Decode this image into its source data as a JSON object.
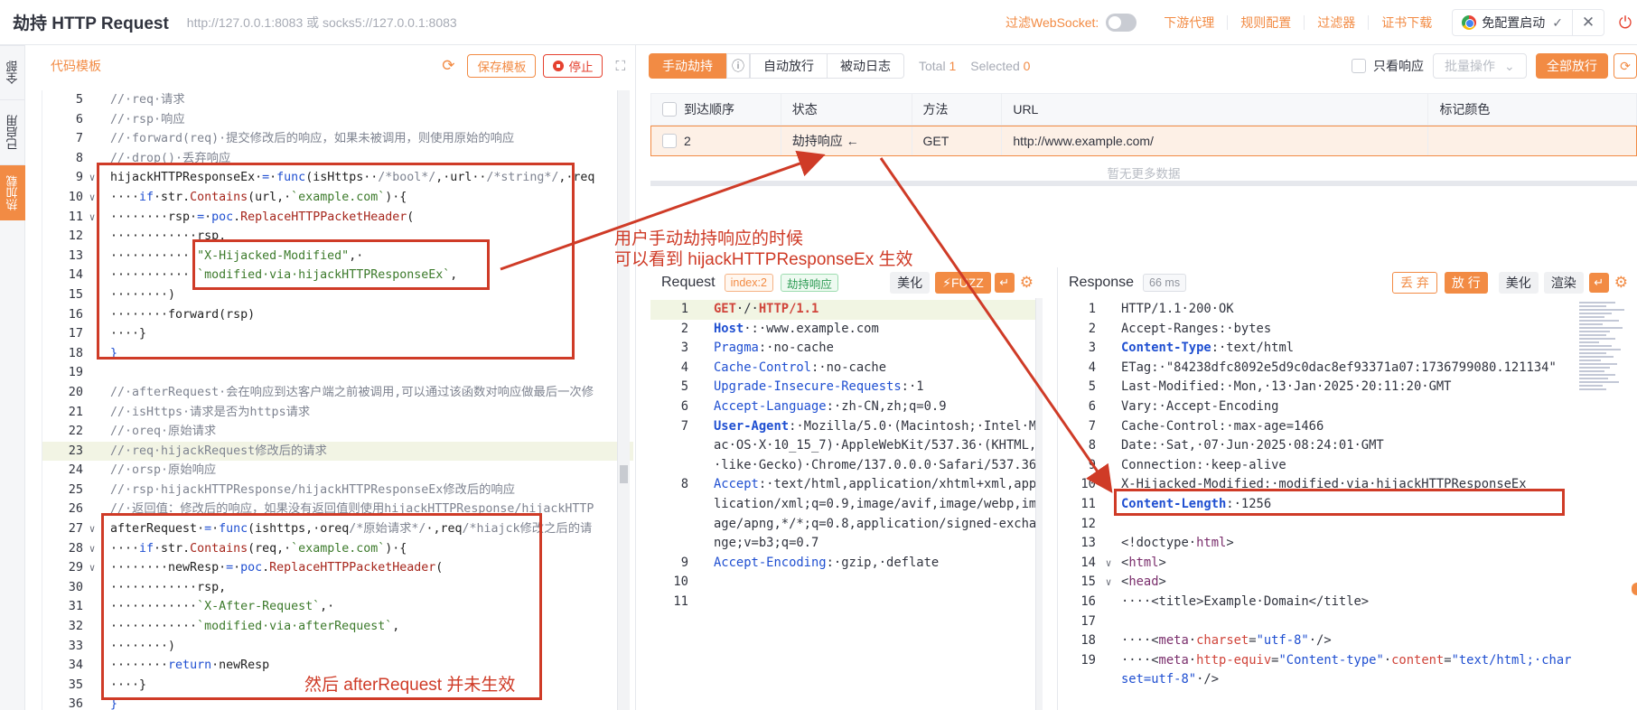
{
  "header": {
    "title": "劫持 HTTP Request",
    "proxy_addr": "http://127.0.0.1:8083 或 socks5://127.0.0.1:8083",
    "ws_filter_label": "过滤WebSocket",
    "links": [
      "下游代理",
      "规则配置",
      "过滤器",
      "证书下载"
    ],
    "chrome_button": "免配置启动"
  },
  "side_tabs": [
    "全部",
    "已启用",
    "热加载"
  ],
  "editor": {
    "title": "代码模板",
    "save_label": "保存模板",
    "stop_label": "停止",
    "lines": [
      {
        "n": "5",
        "f": "",
        "h": false,
        "segs": [
          [
            "c-cm",
            "//·req·请求"
          ]
        ]
      },
      {
        "n": "6",
        "f": "",
        "h": false,
        "segs": [
          [
            "c-cm",
            "//·rsp·响应"
          ]
        ]
      },
      {
        "n": "7",
        "f": "",
        "h": false,
        "segs": [
          [
            "c-cm",
            "//·forward(req)·提交修改后的响应，如果未被调用，则使用原始的响应"
          ]
        ]
      },
      {
        "n": "8",
        "f": "",
        "h": false,
        "segs": [
          [
            "c-cm",
            "//·drop()·丢弃响应"
          ]
        ]
      },
      {
        "n": "9",
        "f": "∨",
        "h": false,
        "segs": [
          [
            "c-pl",
            "hijackHTTPResponseEx·"
          ],
          [
            "c-kw",
            "="
          ],
          [
            "c-pl",
            "·"
          ],
          [
            "c-kw",
            "func"
          ],
          [
            "c-pl",
            "(isHttps··"
          ],
          [
            "c-cm",
            "/*bool*/"
          ],
          [
            "c-pl",
            ",·url··"
          ],
          [
            "c-cm",
            "/*string*/"
          ],
          [
            "c-pl",
            ",·req"
          ]
        ]
      },
      {
        "n": "10",
        "f": "∨",
        "h": false,
        "segs": [
          [
            "c-pl",
            "····"
          ],
          [
            "c-kw",
            "if"
          ],
          [
            "c-pl",
            "·str."
          ],
          [
            "c-fn",
            "Contains"
          ],
          [
            "c-pl",
            "(url,·"
          ],
          [
            "c-st",
            "`example.com`"
          ],
          [
            "c-pl",
            ")·{"
          ]
        ]
      },
      {
        "n": "11",
        "f": "∨",
        "h": false,
        "segs": [
          [
            "c-pl",
            "········rsp·"
          ],
          [
            "c-kw",
            "="
          ],
          [
            "c-pl",
            "·"
          ],
          [
            "c-kw",
            "poc"
          ],
          [
            "c-pl",
            "."
          ],
          [
            "c-fn",
            "ReplaceHTTPPacketHeader"
          ],
          [
            "c-pl",
            "("
          ]
        ]
      },
      {
        "n": "12",
        "f": "",
        "h": false,
        "segs": [
          [
            "c-pl",
            "············rsp,"
          ]
        ]
      },
      {
        "n": "13",
        "f": "",
        "h": false,
        "segs": [
          [
            "c-pl",
            "············"
          ],
          [
            "c-st",
            "\"X-Hijacked-Modified\""
          ],
          [
            "c-pl",
            ",·"
          ]
        ]
      },
      {
        "n": "14",
        "f": "",
        "h": false,
        "segs": [
          [
            "c-pl",
            "············"
          ],
          [
            "c-st",
            "`modified·via·hijackHTTPResponseEx`"
          ],
          [
            "c-pl",
            ","
          ]
        ]
      },
      {
        "n": "15",
        "f": "",
        "h": false,
        "segs": [
          [
            "c-pl",
            "········)"
          ]
        ]
      },
      {
        "n": "16",
        "f": "",
        "h": false,
        "segs": [
          [
            "c-pl",
            "········forward(rsp)"
          ]
        ]
      },
      {
        "n": "17",
        "f": "",
        "h": false,
        "segs": [
          [
            "c-pl",
            "····}"
          ]
        ]
      },
      {
        "n": "18",
        "f": "",
        "h": false,
        "segs": [
          [
            "c-kw",
            "}"
          ]
        ]
      },
      {
        "n": "19",
        "f": "",
        "h": false,
        "segs": [
          [
            "c-pl",
            ""
          ]
        ]
      },
      {
        "n": "20",
        "f": "",
        "h": false,
        "segs": [
          [
            "c-cm",
            "//·afterRequest·会在响应到达客户端之前被调用,可以通过该函数对响应做最后一次修"
          ]
        ]
      },
      {
        "n": "21",
        "f": "",
        "h": false,
        "segs": [
          [
            "c-cm",
            "//·isHttps·请求是否为https请求"
          ]
        ]
      },
      {
        "n": "22",
        "f": "",
        "h": false,
        "segs": [
          [
            "c-cm",
            "//·oreq·原始请求"
          ]
        ]
      },
      {
        "n": "23",
        "f": "",
        "h": true,
        "segs": [
          [
            "c-cm",
            "//·req·hijackRequest修改后的请求"
          ]
        ]
      },
      {
        "n": "24",
        "f": "",
        "h": false,
        "segs": [
          [
            "c-cm",
            "//·orsp·原始响应"
          ]
        ]
      },
      {
        "n": "25",
        "f": "",
        "h": false,
        "segs": [
          [
            "c-cm",
            "//·rsp·hijackHTTPResponse/hijackHTTPResponseEx修改后的响应"
          ]
        ]
      },
      {
        "n": "26",
        "f": "",
        "h": false,
        "segs": [
          [
            "c-cm",
            "//·返回值：修改后的响应，如果没有返回值则使用hijackHTTPResponse/hijackHTTP"
          ]
        ]
      },
      {
        "n": "27",
        "f": "∨",
        "h": false,
        "segs": [
          [
            "c-pl",
            "afterRequest·"
          ],
          [
            "c-kw",
            "="
          ],
          [
            "c-pl",
            "·"
          ],
          [
            "c-kw",
            "func"
          ],
          [
            "c-pl",
            "(ishttps,·oreq"
          ],
          [
            "c-cm",
            "/*原始请求*/"
          ],
          [
            "c-pl",
            "·,req"
          ],
          [
            "c-cm",
            "/*hiajck修改之后的请"
          ]
        ]
      },
      {
        "n": "28",
        "f": "∨",
        "h": false,
        "segs": [
          [
            "c-pl",
            "····"
          ],
          [
            "c-kw",
            "if"
          ],
          [
            "c-pl",
            "·str."
          ],
          [
            "c-fn",
            "Contains"
          ],
          [
            "c-pl",
            "(req,·"
          ],
          [
            "c-st",
            "`example.com`"
          ],
          [
            "c-pl",
            ")·{"
          ]
        ]
      },
      {
        "n": "29",
        "f": "∨",
        "h": false,
        "segs": [
          [
            "c-pl",
            "········newResp·"
          ],
          [
            "c-kw",
            "="
          ],
          [
            "c-pl",
            "·"
          ],
          [
            "c-kw",
            "poc"
          ],
          [
            "c-pl",
            "."
          ],
          [
            "c-fn",
            "ReplaceHTTPPacketHeader"
          ],
          [
            "c-pl",
            "("
          ]
        ]
      },
      {
        "n": "30",
        "f": "",
        "h": false,
        "segs": [
          [
            "c-pl",
            "············rsp,"
          ]
        ]
      },
      {
        "n": "31",
        "f": "",
        "h": false,
        "segs": [
          [
            "c-pl",
            "············"
          ],
          [
            "c-st",
            "`X-After-Request`"
          ],
          [
            "c-pl",
            ",·"
          ]
        ]
      },
      {
        "n": "32",
        "f": "",
        "h": false,
        "segs": [
          [
            "c-pl",
            "············"
          ],
          [
            "c-st",
            "`modified·via·afterRequest`"
          ],
          [
            "c-pl",
            ","
          ]
        ]
      },
      {
        "n": "33",
        "f": "",
        "h": false,
        "segs": [
          [
            "c-pl",
            "········)"
          ]
        ]
      },
      {
        "n": "34",
        "f": "",
        "h": false,
        "segs": [
          [
            "c-pl",
            "········"
          ],
          [
            "c-kw",
            "return"
          ],
          [
            "c-pl",
            "·newResp"
          ]
        ]
      },
      {
        "n": "35",
        "f": "",
        "h": false,
        "segs": [
          [
            "c-pl",
            "····}"
          ]
        ]
      },
      {
        "n": "36",
        "f": "",
        "h": false,
        "segs": [
          [
            "c-kw",
            "}"
          ]
        ]
      }
    ]
  },
  "mitm": {
    "tabs": [
      "手动劫持",
      "自动放行",
      "被动日志"
    ],
    "total_label": "Total",
    "total": "1",
    "selected_label": "Selected",
    "selected": "0",
    "only_response": "只看响应",
    "batch_placeholder": "批量操作",
    "release_all": "全部放行",
    "columns": [
      "到达顺序",
      "状态",
      "方法",
      "URL",
      "标记颜色"
    ],
    "rows": [
      {
        "order": "2",
        "status": "劫持响应 ←",
        "method": "GET",
        "url": "http://www.example.com/",
        "color": ""
      }
    ],
    "empty_text": "暂无更多数据"
  },
  "request": {
    "title": "Request",
    "index_tag": "index:2",
    "status_tag": "劫持响应",
    "beautify": "美化",
    "fuzz": "FUZZ",
    "lines": [
      {
        "n": "1",
        "f": "",
        "segs": [
          [
            "k-meth",
            "GET"
          ],
          [
            "",
            "·/·"
          ],
          [
            "k-meth",
            "HTTP/1.1"
          ]
        ]
      },
      {
        "n": "2",
        "f": "",
        "segs": [
          [
            "k-hdb",
            "Host"
          ],
          [
            "",
            "·:·www.example.com"
          ]
        ]
      },
      {
        "n": "3",
        "f": "",
        "segs": [
          [
            "k-hd",
            "Pragma"
          ],
          [
            "",
            ":·no-cache"
          ]
        ]
      },
      {
        "n": "4",
        "f": "",
        "segs": [
          [
            "k-hd",
            "Cache-Control"
          ],
          [
            "",
            ":·no-cache"
          ]
        ]
      },
      {
        "n": "5",
        "f": "",
        "segs": [
          [
            "k-hd",
            "Upgrade-Insecure-Requests"
          ],
          [
            "",
            ":·1"
          ]
        ]
      },
      {
        "n": "6",
        "f": "",
        "segs": [
          [
            "k-hd",
            "Accept-Language"
          ],
          [
            "",
            ":·zh-CN,zh;q=0.9"
          ]
        ]
      },
      {
        "n": "7",
        "f": "",
        "segs": [
          [
            "k-hdb",
            "User-Agent"
          ],
          [
            "",
            ":·Mozilla/5.0·(Macintosh;·Intel·Mac·OS·X·10_15_7)·AppleWebKit/537.36·(KHTML,·like·Gecko)·Chrome/137.0.0.0·Safari/537.36"
          ]
        ]
      },
      {
        "n": "8",
        "f": "",
        "segs": [
          [
            "k-hd",
            "Accept"
          ],
          [
            "",
            ":·text/html,application/xhtml+xml,application/xml;q=0.9,image/avif,image/webp,image/apng,*/*;q=0.8,application/signed-exchange;v=b3;q=0.7"
          ]
        ]
      },
      {
        "n": "9",
        "f": "",
        "segs": [
          [
            "k-hd",
            "Accept-Encoding"
          ],
          [
            "",
            ":·gzip,·deflate"
          ]
        ]
      },
      {
        "n": "10",
        "f": "",
        "segs": [
          [
            "",
            ""
          ]
        ]
      },
      {
        "n": "11",
        "f": "",
        "segs": [
          [
            "",
            ""
          ]
        ]
      }
    ]
  },
  "response": {
    "title": "Response",
    "time_tag": "66 ms",
    "discard": "丢 弃",
    "release": "放 行",
    "beautify": "美化",
    "render": "渲染",
    "lines": [
      {
        "n": "1",
        "f": "",
        "segs": [
          [
            "",
            "HTTP/1.1·200·OK"
          ]
        ]
      },
      {
        "n": "2",
        "f": "",
        "segs": [
          [
            "",
            "Accept-Ranges:·bytes"
          ]
        ]
      },
      {
        "n": "3",
        "f": "",
        "segs": [
          [
            "k-hdb",
            "Content-Type"
          ],
          [
            "",
            ":·text/html"
          ]
        ]
      },
      {
        "n": "4",
        "f": "",
        "segs": [
          [
            "",
            "ETag:·\"84238dfc8092e5d9c0dac8ef93371a07:1736799080.121134\""
          ]
        ]
      },
      {
        "n": "5",
        "f": "",
        "segs": [
          [
            "",
            "Last-Modified:·Mon,·13·Jan·2025·20:11:20·GMT"
          ]
        ]
      },
      {
        "n": "6",
        "f": "",
        "segs": [
          [
            "",
            "Vary:·Accept-Encoding"
          ]
        ]
      },
      {
        "n": "7",
        "f": "",
        "segs": [
          [
            "",
            "Cache-Control:·max-age=1466"
          ]
        ]
      },
      {
        "n": "8",
        "f": "",
        "segs": [
          [
            "",
            "Date:·Sat,·07·Jun·2025·08:24:01·GMT"
          ]
        ]
      },
      {
        "n": "9",
        "f": "",
        "segs": [
          [
            "",
            "Connection:·keep-alive"
          ]
        ]
      },
      {
        "n": "10",
        "f": "",
        "segs": [
          [
            "",
            "X-Hijacked-Modified:·modified·via·hijackHTTPResponseEx"
          ]
        ]
      },
      {
        "n": "11",
        "f": "",
        "segs": [
          [
            "k-hdb",
            "Content-Length"
          ],
          [
            "",
            ":·1256"
          ]
        ]
      },
      {
        "n": "12",
        "f": "",
        "segs": [
          [
            "",
            ""
          ]
        ]
      },
      {
        "n": "13",
        "f": "",
        "segs": [
          [
            "",
            "<!doctype·"
          ],
          [
            "k-tag",
            "html"
          ],
          [
            "",
            ">"
          ]
        ]
      },
      {
        "n": "14",
        "f": "∨",
        "segs": [
          [
            "",
            "<"
          ],
          [
            "k-tag",
            "html"
          ],
          [
            "",
            ">"
          ]
        ]
      },
      {
        "n": "15",
        "f": "∨",
        "segs": [
          [
            "",
            "<"
          ],
          [
            "k-tag",
            "head"
          ],
          [
            "",
            ">"
          ]
        ]
      },
      {
        "n": "16",
        "f": "",
        "segs": [
          [
            "",
            "····<title>Example·Domain</title>"
          ]
        ]
      },
      {
        "n": "17",
        "f": "",
        "segs": [
          [
            "",
            ""
          ]
        ]
      },
      {
        "n": "18",
        "f": "",
        "segs": [
          [
            "",
            "····<"
          ],
          [
            "k-tag",
            "meta"
          ],
          [
            "",
            "·"
          ],
          [
            "k-at",
            "charset"
          ],
          [
            "",
            "="
          ],
          [
            "k-av",
            "\"utf-8\""
          ],
          [
            "",
            "·/>"
          ]
        ]
      },
      {
        "n": "19",
        "f": "",
        "segs": [
          [
            "",
            "····<"
          ],
          [
            "k-tag",
            "meta"
          ],
          [
            "",
            "·"
          ],
          [
            "k-at",
            "http-equiv"
          ],
          [
            "",
            "="
          ],
          [
            "k-av",
            "\"Content-type\""
          ],
          [
            "",
            "·"
          ],
          [
            "k-at",
            "content"
          ],
          [
            "",
            "="
          ],
          [
            "k-av",
            "\"text/html;·charset=utf-8\""
          ],
          [
            "",
            "·/>"
          ]
        ]
      }
    ]
  },
  "annotations": {
    "note1_line1": "用户手动劫持响应的时候",
    "note1_line2": "可以看到 hijackHTTPResponseEx 生效",
    "note2": "然后 afterRequest 并未生效"
  }
}
